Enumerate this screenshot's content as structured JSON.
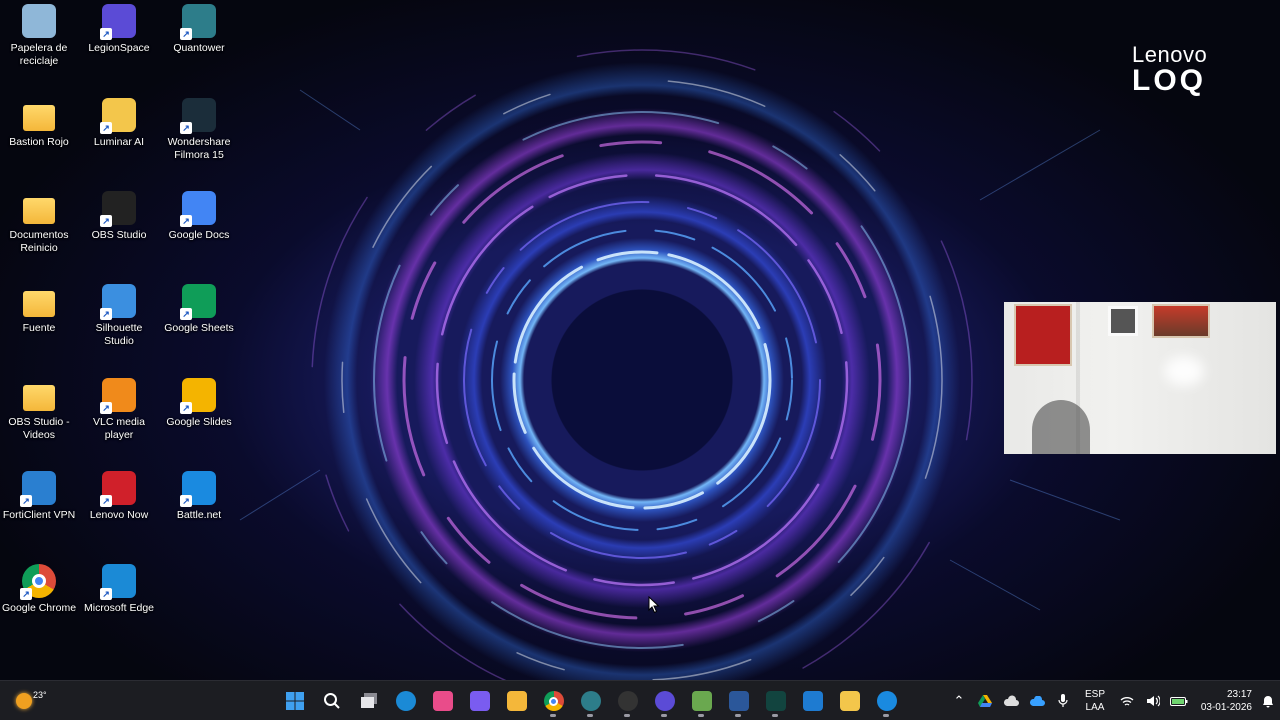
{
  "desktop": {
    "icons": [
      {
        "label": "Papelera de reciclaje",
        "icon": "recycle-bin-icon",
        "color": "#8fb7d8"
      },
      {
        "label": "Bastion Rojo",
        "icon": "folder-icon",
        "color": "#f4b73a"
      },
      {
        "label": "Documentos Reinicio",
        "icon": "folder-icon",
        "color": "#f4b73a"
      },
      {
        "label": "Fuente",
        "icon": "folder-icon",
        "color": "#f4b73a"
      },
      {
        "label": "OBS Studio - Videos",
        "icon": "folder-icon",
        "color": "#f4b73a"
      },
      {
        "label": "FortiClient VPN",
        "icon": "forticlient-icon",
        "color": "#2a7fd0"
      },
      {
        "label": "Google Chrome",
        "icon": "chrome-icon",
        "color": "#dd4b39"
      },
      {
        "label": "LegionSpace",
        "icon": "legionspace-icon",
        "color": "#5b4bd6"
      },
      {
        "label": "Luminar AI",
        "icon": "luminar-icon",
        "color": "#f3c64b"
      },
      {
        "label": "OBS Studio",
        "icon": "obs-icon",
        "color": "#222"
      },
      {
        "label": "Silhouette Studio",
        "icon": "silhouette-icon",
        "color": "#3b8fe0"
      },
      {
        "label": "VLC media player",
        "icon": "vlc-icon",
        "color": "#f08a1b"
      },
      {
        "label": "Lenovo Now",
        "icon": "lenovo-now-icon",
        "color": "#d0202a"
      },
      {
        "label": "Microsoft Edge",
        "icon": "edge-icon",
        "color": "#1b8ad6"
      },
      {
        "label": "Quantower",
        "icon": "quantower-icon",
        "color": "#2d7d8a"
      },
      {
        "label": "Wondershare Filmora 15",
        "icon": "filmora-icon",
        "color": "#1b2d3a"
      },
      {
        "label": "Google Docs",
        "icon": "google-docs-icon",
        "color": "#4285f4"
      },
      {
        "label": "Google Sheets",
        "icon": "google-sheets-icon",
        "color": "#0f9d58"
      },
      {
        "label": "Google Slides",
        "icon": "google-slides-icon",
        "color": "#f4b400"
      },
      {
        "label": "Battle.net",
        "icon": "battlenet-icon",
        "color": "#1a8ae0"
      }
    ]
  },
  "logo": {
    "brand": "Lenovo",
    "model": "LOQ"
  },
  "taskbar": {
    "weather": {
      "temp": "23°"
    },
    "apps": [
      {
        "name": "start-button",
        "color": "#3fa0f0"
      },
      {
        "name": "search-button",
        "color": "#ffffff"
      },
      {
        "name": "task-view-button",
        "color": "#cfcfd6"
      },
      {
        "name": "taskbar-edge",
        "color": "#1b8ad6"
      },
      {
        "name": "taskbar-app-blossom",
        "color": "#e94c8a"
      },
      {
        "name": "taskbar-copilot",
        "color": "#7a5cf0"
      },
      {
        "name": "taskbar-file-explorer",
        "color": "#f4b73a"
      },
      {
        "name": "taskbar-chrome",
        "color": "#dd4b39"
      },
      {
        "name": "taskbar-quantower",
        "color": "#2d7d8a"
      },
      {
        "name": "taskbar-obs",
        "color": "#333"
      },
      {
        "name": "taskbar-legionspace",
        "color": "#5b4bd6"
      },
      {
        "name": "taskbar-notepad-plus",
        "color": "#6aa84f"
      },
      {
        "name": "taskbar-word",
        "color": "#2b579a"
      },
      {
        "name": "taskbar-filmora",
        "color": "#12443f"
      },
      {
        "name": "taskbar-vscode",
        "color": "#1e7bd1"
      },
      {
        "name": "taskbar-luminar",
        "color": "#f3c64b"
      },
      {
        "name": "taskbar-battlenet",
        "color": "#1a8ae0"
      }
    ],
    "tray": {
      "lang_line1": "ESP",
      "lang_line2": "LAA",
      "time": "23:17",
      "date": "03-01-2026"
    }
  }
}
